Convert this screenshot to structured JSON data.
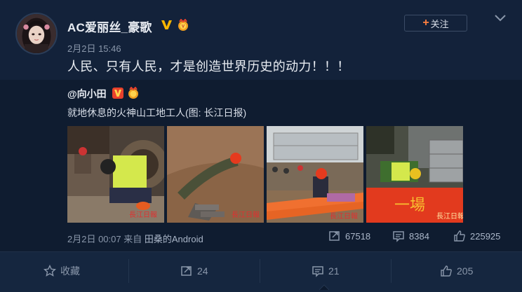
{
  "post": {
    "username": "AC爱丽丝_豪歌",
    "timestamp": "2月2日 15:46",
    "text": "人民、只有人民，才是创造世界历史的动力！！！",
    "follow_label": "关注"
  },
  "repost": {
    "username": "@向小田",
    "text": "就地休息的火神山工地工人(图: 长江日报)",
    "meta_time": "2月2日 00:07",
    "meta_from": "来自",
    "meta_source": "田桑的Android",
    "stats": {
      "reposts": "67518",
      "comments": "8384",
      "likes": "225925"
    }
  },
  "actions": {
    "favorite": "收藏",
    "repost": "24",
    "comment": "21",
    "like": "205"
  },
  "icons": [
    "avatar",
    "v-badge-icon",
    "medal-icon",
    "plus-icon",
    "chevron-down-icon",
    "repost-icon",
    "comment-icon",
    "like-icon",
    "star-icon"
  ],
  "colors": {
    "background": "#13223a",
    "accent_orange": "#ff8140",
    "verified_gold": "#f7b500",
    "text_primary": "#e8ecf2",
    "text_secondary": "#8a97aa"
  }
}
